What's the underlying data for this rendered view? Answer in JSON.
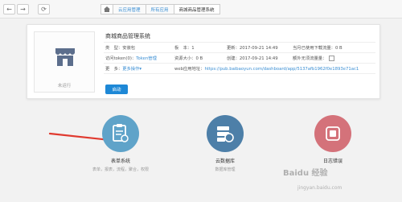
{
  "nav": {
    "back_glyph": "←",
    "forward_glyph": "→",
    "refresh_glyph": "⟳"
  },
  "breadcrumb": {
    "home_icon": "home-icon",
    "items": [
      "云应用管理",
      "所有应用",
      "商城商品管理系统"
    ]
  },
  "app": {
    "title": "商城商品管理系统",
    "status": "未运行",
    "row1": {
      "type": "类　型：安装包",
      "version": "板　本：1",
      "updated": "更新：2017-09-21 14:49",
      "traffic": "当月已使用下载流量：0 B"
    },
    "row2": {
      "token_label": "访问token(0)：",
      "token_link": "Token管理",
      "size": "资源大小：0 B",
      "created": "创建：2017-09-21 14:49",
      "free_traffic": "额外无须流量量："
    },
    "row3": {
      "more_label": "更　多：",
      "more_link": "更多操作▾",
      "url_label": "web应用地址：",
      "url": "https://pub.baibaoyun.com/dashboard/app/5137afb1962f0e1893e71ac1"
    },
    "launch_label": "启动"
  },
  "modules": [
    {
      "title": "表单系统",
      "subtitle": "表单，报表，流程，聚合，权限",
      "icon": "form-icon",
      "color": "#5fa3c9"
    },
    {
      "title": "云数据库",
      "subtitle": "数据库管理",
      "icon": "database-icon",
      "color": "#4d7fa8"
    },
    {
      "title": "日志错误",
      "subtitle": "",
      "icon": "log-icon",
      "color": "#d4727a"
    }
  ],
  "watermark": {
    "main": "Baidu 经验",
    "sub": "jingyan.baidu.com"
  }
}
